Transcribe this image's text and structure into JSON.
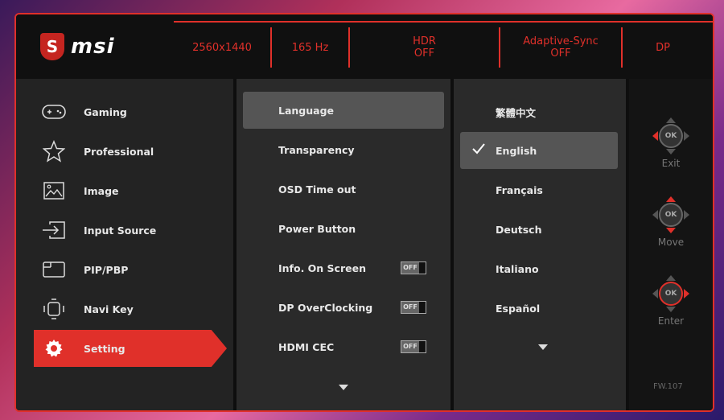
{
  "brand": {
    "logo_text": "msi",
    "logo_mark": "S"
  },
  "status": [
    {
      "line1": "2560x1440",
      "line2": ""
    },
    {
      "line1": "165 Hz",
      "line2": ""
    },
    {
      "line1": "HDR",
      "line2": "OFF"
    },
    {
      "line1": "Adaptive-Sync",
      "line2": "OFF"
    },
    {
      "line1": "DP",
      "line2": ""
    }
  ],
  "main_menu": [
    {
      "label": "Gaming",
      "icon": "gamepad-icon"
    },
    {
      "label": "Professional",
      "icon": "star-icon"
    },
    {
      "label": "Image",
      "icon": "image-icon"
    },
    {
      "label": "Input Source",
      "icon": "input-source-icon"
    },
    {
      "label": "PIP/PBP",
      "icon": "pip-icon"
    },
    {
      "label": "Navi Key",
      "icon": "navi-key-icon"
    },
    {
      "label": "Setting",
      "icon": "gear-icon",
      "active": true
    }
  ],
  "settings_menu": [
    {
      "label": "Language",
      "active": true
    },
    {
      "label": "Transparency"
    },
    {
      "label": "OSD Time out"
    },
    {
      "label": "Power Button"
    },
    {
      "label": "Info. On Screen",
      "toggle": "OFF"
    },
    {
      "label": "DP OverClocking",
      "toggle": "OFF"
    },
    {
      "label": "HDMI CEC",
      "toggle": "OFF"
    }
  ],
  "languages": [
    {
      "label": "繁體中文"
    },
    {
      "label": "English",
      "selected": true
    },
    {
      "label": "Français"
    },
    {
      "label": "Deutsch"
    },
    {
      "label": "Italiano"
    },
    {
      "label": "Español"
    }
  ],
  "nav_buttons": [
    {
      "label": "Exit",
      "center": "OK"
    },
    {
      "label": "Move",
      "center": "OK"
    },
    {
      "label": "Enter",
      "center": "OK"
    }
  ],
  "firmware": "FW.107",
  "colors": {
    "accent": "#e0302a",
    "panel": "#2a2a2a",
    "highlight": "#555555"
  }
}
